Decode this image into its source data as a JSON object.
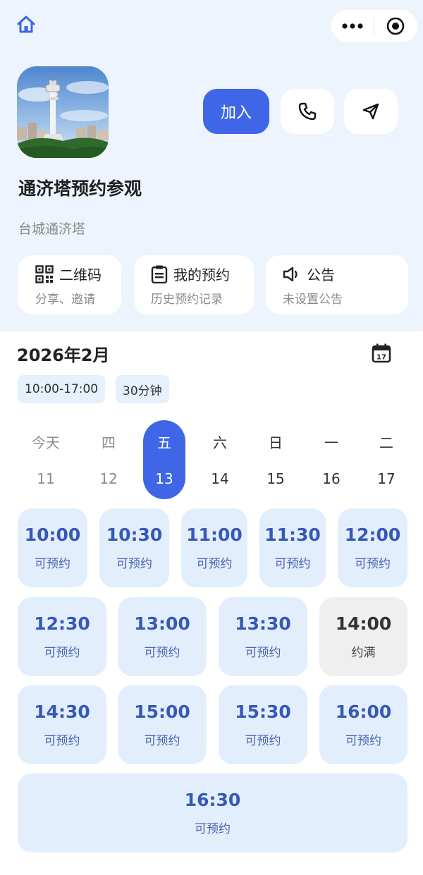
{
  "header": {
    "home_icon": "home-icon",
    "more_icon": "more-dots-icon",
    "target_icon": "target-icon",
    "accent": "#3e66e6"
  },
  "venue": {
    "title": "通济塔预约参观",
    "subtitle": "台城通济塔",
    "join_label": "加入",
    "phone_icon": "phone-icon",
    "navigate_icon": "navigate-icon"
  },
  "cards": [
    {
      "icon": "qrcode-icon",
      "label": "二维码",
      "desc": "分享、邀请"
    },
    {
      "icon": "clipboard-icon",
      "label": "我的预约",
      "desc": "历史预约记录"
    },
    {
      "icon": "speaker-icon",
      "label": "公告",
      "desc": "未设置公告"
    }
  ],
  "calendar": {
    "month": "2026年2月",
    "hours": "10:00-17:00",
    "duration": "30分钟",
    "days": [
      {
        "weekday": "今天",
        "date": "11"
      },
      {
        "weekday": "四",
        "date": "12"
      },
      {
        "weekday": "五",
        "date": "13"
      },
      {
        "weekday": "六",
        "date": "14"
      },
      {
        "weekday": "日",
        "date": "15"
      },
      {
        "weekday": "一",
        "date": "16"
      },
      {
        "weekday": "二",
        "date": "17"
      }
    ],
    "selected_index": 2
  },
  "slots": [
    {
      "time": "10:00",
      "status": "可预约"
    },
    {
      "time": "10:30",
      "status": "可预约"
    },
    {
      "time": "11:00",
      "status": "可预约"
    },
    {
      "time": "11:30",
      "status": "可预约"
    },
    {
      "time": "12:00",
      "status": "可预约"
    },
    {
      "time": "12:30",
      "status": "可预约"
    },
    {
      "time": "13:00",
      "status": "可预约"
    },
    {
      "time": "13:30",
      "status": "可预约"
    },
    {
      "time": "14:00",
      "status": "约满"
    },
    {
      "time": "14:30",
      "status": "可预约"
    },
    {
      "time": "15:00",
      "status": "可预约"
    },
    {
      "time": "15:30",
      "status": "可预约"
    },
    {
      "time": "16:00",
      "status": "可预约"
    },
    {
      "time": "16:30",
      "status": "可预约"
    }
  ]
}
